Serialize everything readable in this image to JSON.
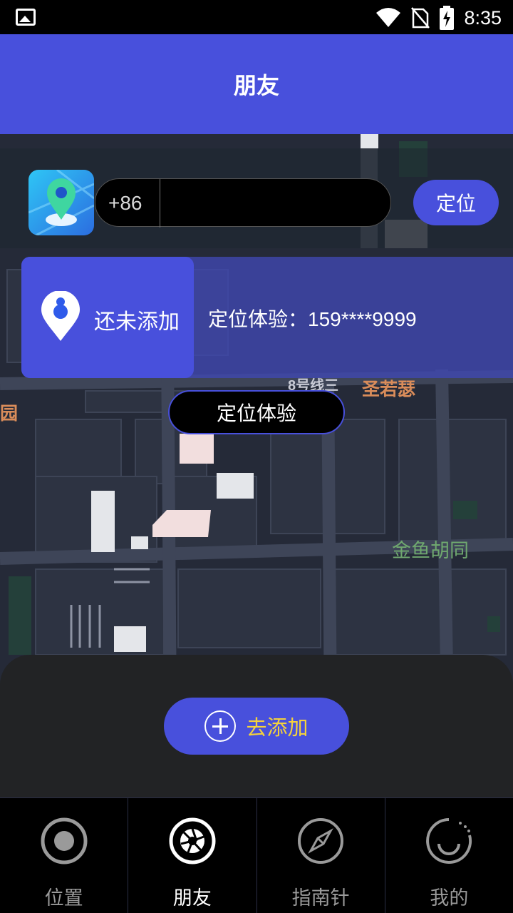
{
  "status_bar": {
    "time": "8:35",
    "icons": [
      "image-icon",
      "wifi-icon",
      "no-sim-icon",
      "battery-charging-icon"
    ]
  },
  "header": {
    "title": "朋友"
  },
  "search": {
    "prefix": "+86",
    "value": "",
    "placeholder": "",
    "locate_label": "定位"
  },
  "friend_card": {
    "status": "还未添加",
    "demo_number": "定位体验：159****9999"
  },
  "demo_button": {
    "label": "定位体验"
  },
  "map": {
    "labels": [
      {
        "text": "8号线三",
        "color": "#c9cbd6"
      },
      {
        "text": "圣若瑟",
        "color": "#d98c5a"
      },
      {
        "text": "园",
        "color": "#d98c5a"
      },
      {
        "text": "金鱼胡同",
        "color": "#6fa86f"
      }
    ]
  },
  "add_button": {
    "label": "去添加"
  },
  "tabs": [
    {
      "label": "位置",
      "icon": "location-ring-icon",
      "active": false
    },
    {
      "label": "朋友",
      "icon": "aperture-icon",
      "active": true
    },
    {
      "label": "指南针",
      "icon": "compass-icon",
      "active": false
    },
    {
      "label": "我的",
      "icon": "profile-spinner-icon",
      "active": false
    }
  ],
  "colors": {
    "brand": "#4850dc",
    "accent_text": "#f4d23c",
    "map_background": "#252a38"
  }
}
